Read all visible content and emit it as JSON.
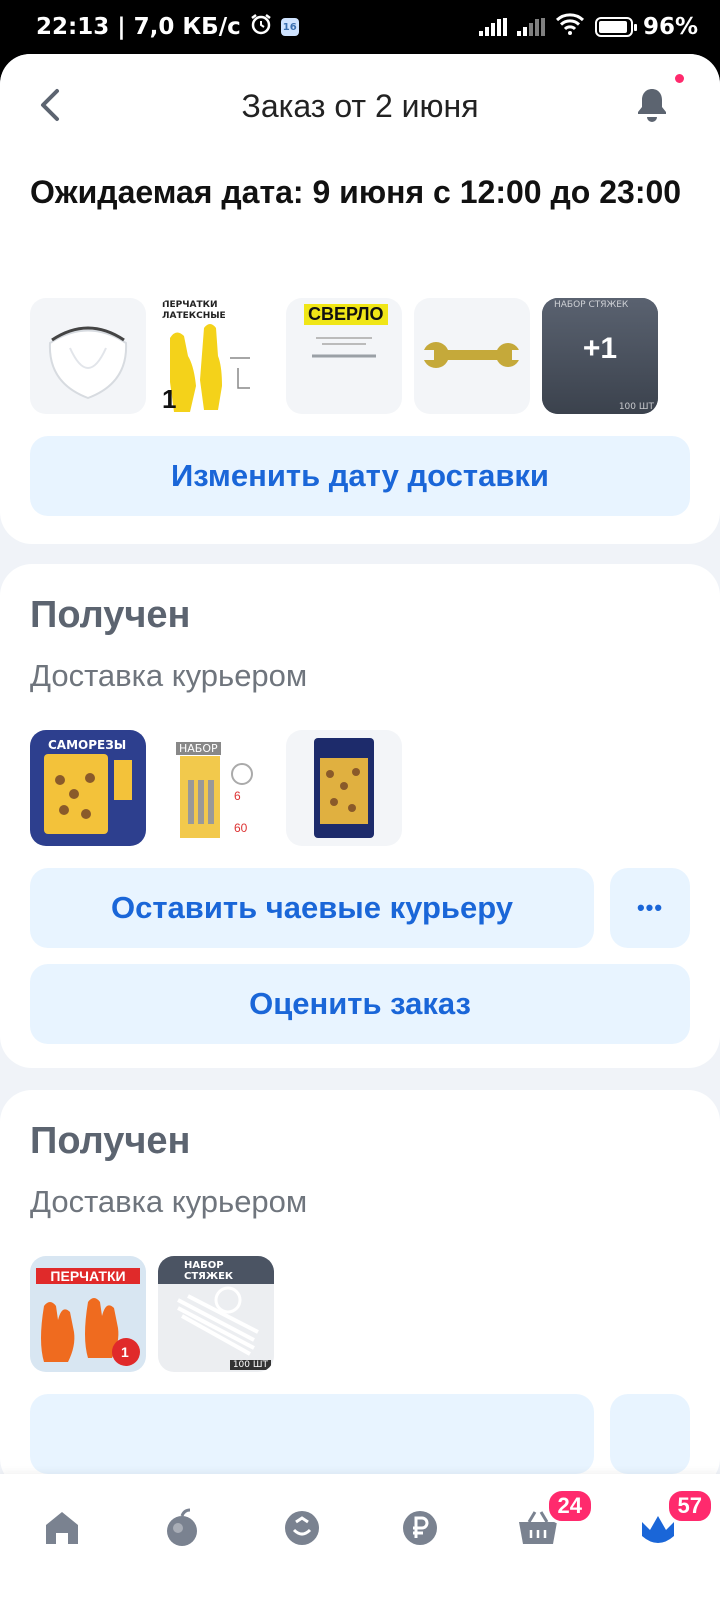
{
  "statusbar": {
    "time": "22:13",
    "speed": "7,0 КБ/с",
    "sim": "16",
    "battery": "96%"
  },
  "header": {
    "title": "Заказ от 2 июня"
  },
  "order": {
    "expected": "Ожидаемая дата: 9 июня с 12:00 до 23:00",
    "more_count": "+1",
    "change_date": "Изменить дату доставки"
  },
  "shipments": [
    {
      "status": "Получен",
      "method": "Доставка курьером",
      "tip_label": "Оставить чаевые курьеру",
      "more_label": "•••",
      "rate_label": "Оценить заказ"
    },
    {
      "status": "Получен",
      "method": "Доставка курьером"
    }
  ],
  "products": {
    "gloves_latex": "ПЕРЧАТКИ ЛАТЕКСНЫЕ",
    "drill": "СВЕРЛО",
    "ties": "НАБОР СТЯЖЕК",
    "screws": "САМОРЕЗЫ",
    "set": "НАБОР",
    "gloves_house": "ПЕРЧАТКИ",
    "count100": "100 ШТ"
  },
  "nav": {
    "cart_badge": "24",
    "profile_badge": "57"
  },
  "colors": {
    "accent": "#1a66d8",
    "button_bg": "#e8f4ff",
    "badge": "#ff2a6d"
  }
}
